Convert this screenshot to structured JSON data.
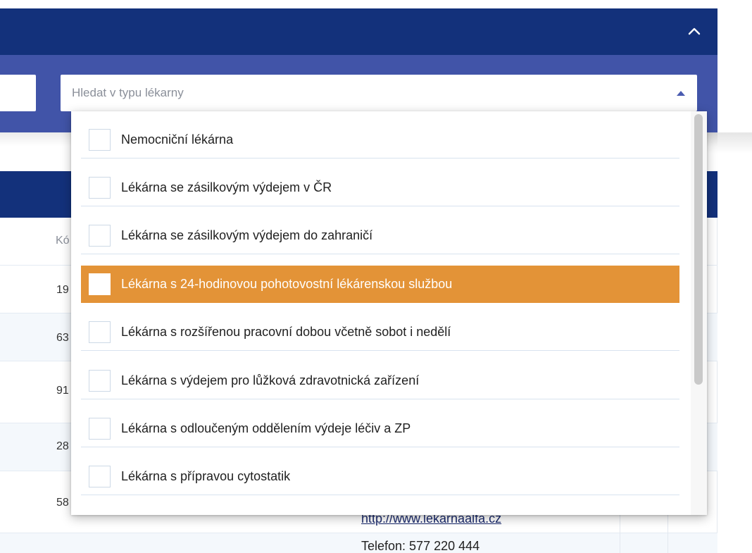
{
  "search": {
    "type_placeholder": "Hledat v typu lékarny"
  },
  "icons": {
    "collapse": "chevron-up-icon",
    "dropdown_caret": "caret-up-icon"
  },
  "colors": {
    "header": "#13317b",
    "filter_band": "#4154a8",
    "highlight": "#e39337"
  },
  "table": {
    "column_header_partial": "Kó",
    "rows_partial": [
      "19",
      "63",
      "91",
      "28",
      "58"
    ],
    "link": "http://www.lekarnaalfa.cz",
    "phone": "Telefon: 577 220 444"
  },
  "dropdown": {
    "options": [
      {
        "label": "Nemocniční lékárna",
        "checked": false
      },
      {
        "label": "Lékárna se zásilkovým výdejem v ČR",
        "checked": false
      },
      {
        "label": "Lékárna se zásilkovým výdejem do zahraničí",
        "checked": false
      },
      {
        "label": "Lékárna s 24-hodinovou pohotovostní lékárenskou službou",
        "checked": false,
        "highlighted": true
      },
      {
        "label": "Lékárna s rozšířenou pracovní dobou včetně sobot i nedělí",
        "checked": false
      },
      {
        "label": "Lékárna s výdejem pro lůžková zdravotnická zařízení",
        "checked": false
      },
      {
        "label": "Lékárna s odloučeným oddělením výdeje léčiv a ZP",
        "checked": false
      },
      {
        "label": "Lékárna s přípravou cytostatik",
        "checked": false
      }
    ]
  }
}
